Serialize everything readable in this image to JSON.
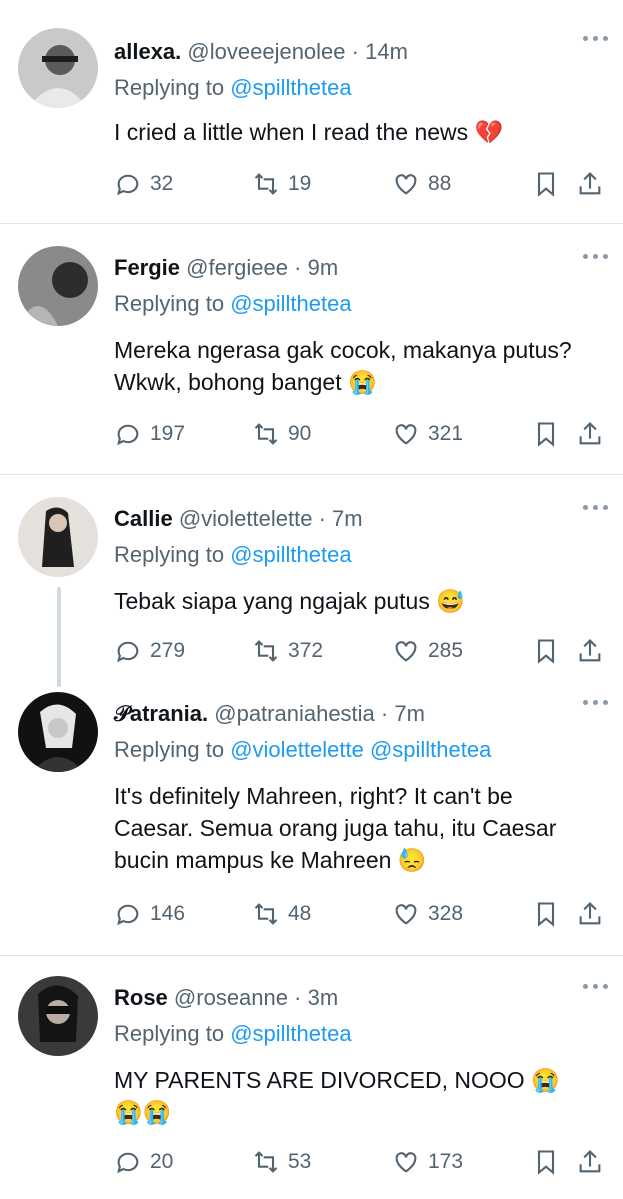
{
  "tweets": [
    {
      "name": "allexa.",
      "handle": "@loveeejenolee",
      "time": "14m",
      "reply_prefix": "Replying to",
      "reply_to": "@spillthetea",
      "text": "I cried a little when I read the news 💔",
      "replies": "32",
      "retweets": "19",
      "likes": "88",
      "avatar_color": "#9a9a9a"
    },
    {
      "name": "Fergie",
      "handle": "@fergieee",
      "time": "9m",
      "reply_prefix": "Replying to",
      "reply_to": "@spillthetea",
      "text": "Mereka ngerasa gak cocok, makanya putus? Wkwk, bohong banget 😭",
      "replies": "197",
      "retweets": "90",
      "likes": "321",
      "avatar_color": "#6e6e6e"
    },
    {
      "name": "Callie",
      "handle": "@violettelette",
      "time": "7m",
      "reply_prefix": "Replying to",
      "reply_to": "@spillthetea",
      "text": "Tebak siapa yang ngajak putus 😅",
      "replies": "279",
      "retweets": "372",
      "likes": "285",
      "avatar_color": "#d8d4cf"
    },
    {
      "name": "𝒫atrania.",
      "handle": "@patraniahestia",
      "time": "7m",
      "reply_prefix": "Replying to",
      "reply_to": "@violettelette @spillthetea",
      "text": "It's definitely Mahreen, right? It can't be Caesar. Semua orang juga tahu, itu Caesar bucin mampus ke Mahreen 😓",
      "replies": "146",
      "retweets": "48",
      "likes": "328",
      "avatar_color": "#1a1a1a"
    },
    {
      "name": "Rose",
      "handle": "@roseanne",
      "time": "3m",
      "reply_prefix": "Replying to",
      "reply_to": "@spillthetea",
      "text": "MY PARENTS ARE DIVORCED, NOOO 😭 😭😭",
      "replies": "20",
      "retweets": "53",
      "likes": "173",
      "avatar_color": "#2b2b2b"
    }
  ],
  "colors": {
    "accent": "#1d9bf0",
    "secondary": "#536471",
    "divider": "#dfe3e6"
  },
  "icons": {
    "reply": "speech-bubble-icon",
    "retweet": "retweet-icon",
    "like": "heart-icon",
    "bookmark": "bookmark-icon",
    "share": "share-icon",
    "more": "more-dots-icon"
  }
}
